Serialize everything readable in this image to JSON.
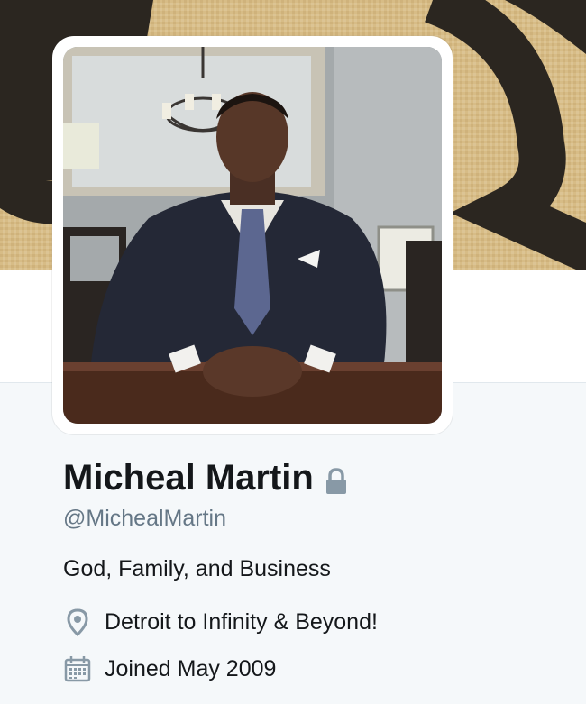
{
  "profile": {
    "name": "Micheal Martin",
    "handle": "@MichealMartin",
    "bio": "God, Family, and Business",
    "location": "Detroit to Infinity & Beyond!",
    "joined": "Joined May 2009"
  },
  "icons": {
    "protected": "lock-icon",
    "location": "location-pin-icon",
    "joined": "calendar-icon"
  },
  "colors": {
    "name_text": "#14171a",
    "secondary_text": "#657786",
    "icon": "#8899a6",
    "page_background": "#f5f8fa"
  }
}
